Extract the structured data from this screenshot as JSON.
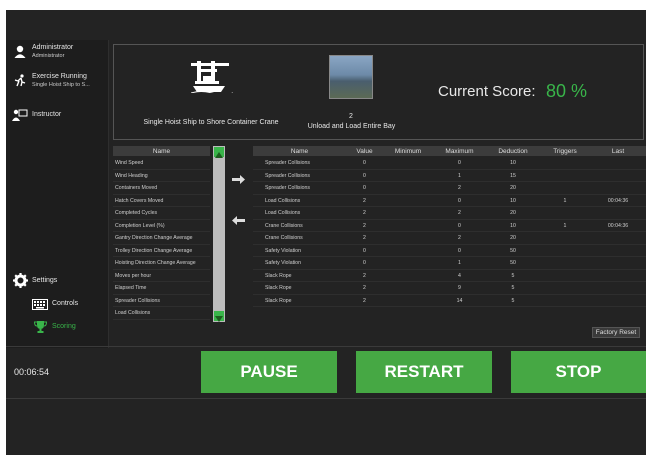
{
  "sidebar": {
    "user_name": "Administrator",
    "user_role": "Administrator",
    "exercise_status": "Exercise Running",
    "exercise_name": "Single Hoist Ship to S...",
    "instructor": "Instructor",
    "settings": "Settings",
    "controls": "Controls",
    "scoring": "Scoring"
  },
  "header": {
    "crane_name": "Single Hoist Ship to Shore Container Crane",
    "exercise_number": "2",
    "exercise_title": "Unload and Load Entire Bay",
    "score_label": "Current Score:",
    "score_value": "80 %"
  },
  "available": {
    "column": "Name",
    "items": [
      "Wind Speed",
      "Wind Heading",
      "Containers Moved",
      "Hatch Covers Moved",
      "Completed Cycles",
      "Completion Level (%)",
      "Gantry Direction Change Average",
      "Trolley Direction Change Average",
      "Hoisting Direction Change Average",
      "Moves per hour",
      "Elapsed Time",
      "Spreader Collisions",
      "Load Collisions"
    ]
  },
  "scoring": {
    "columns": [
      "Name",
      "Value",
      "Minimum",
      "Maximum",
      "Deduction",
      "Triggers",
      "Last"
    ],
    "rows": [
      [
        "Spreader Collisions",
        "0",
        "",
        "0",
        "10",
        "",
        ""
      ],
      [
        "Spreader Collisions",
        "0",
        "",
        "1",
        "15",
        "",
        ""
      ],
      [
        "Spreader Collisions",
        "0",
        "",
        "2",
        "20",
        "",
        ""
      ],
      [
        "Load Collisions",
        "2",
        "",
        "0",
        "10",
        "1",
        "00:04:36"
      ],
      [
        "Load Collisions",
        "2",
        "",
        "2",
        "20",
        "",
        ""
      ],
      [
        "Crane Collisions",
        "2",
        "",
        "0",
        "10",
        "1",
        "00:04:36"
      ],
      [
        "Crane Collisions",
        "2",
        "",
        "2",
        "20",
        "",
        ""
      ],
      [
        "Safety Violation",
        "0",
        "",
        "0",
        "50",
        "",
        ""
      ],
      [
        "Safety Violation",
        "0",
        "",
        "1",
        "50",
        "",
        ""
      ],
      [
        "Slack Rope",
        "2",
        "",
        "4",
        "5",
        "",
        ""
      ],
      [
        "Slack Rope",
        "2",
        "",
        "9",
        "5",
        "",
        ""
      ],
      [
        "Slack Rope",
        "2",
        "",
        "14",
        "5",
        "",
        ""
      ]
    ]
  },
  "factory_reset": "Factory Reset",
  "timer": "00:06:54",
  "buttons": {
    "pause": "PAUSE",
    "restart": "RESTART",
    "stop": "STOP"
  },
  "colors": {
    "accent_green": "#39b54a",
    "button_green": "#46a844",
    "background": "#232323"
  }
}
